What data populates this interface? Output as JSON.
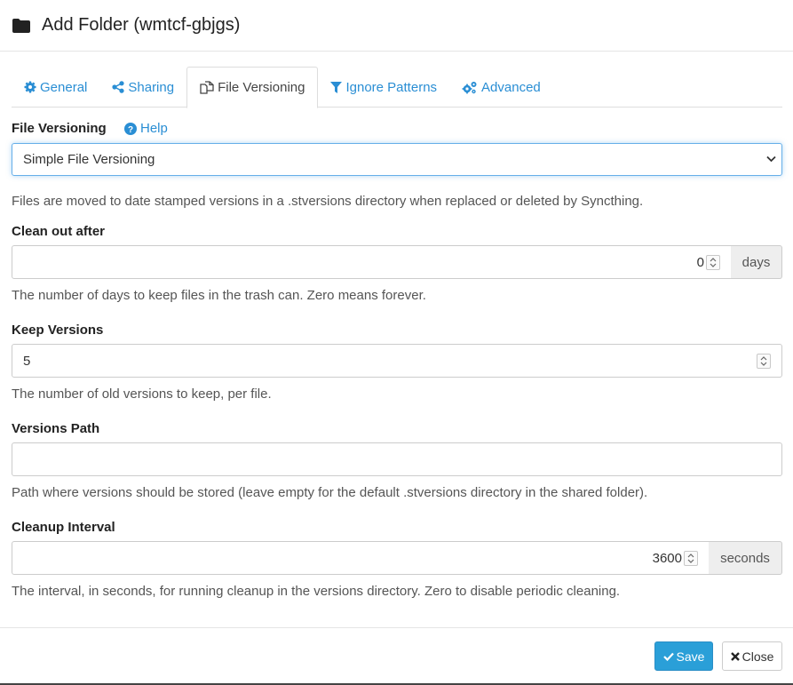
{
  "dialog": {
    "title": "Add Folder (wmtcf-gbjgs)"
  },
  "tabs": [
    {
      "label": "General",
      "icon": "gear-icon"
    },
    {
      "label": "Sharing",
      "icon": "share-icon"
    },
    {
      "label": "File Versioning",
      "icon": "copy-icon",
      "active": true
    },
    {
      "label": "Ignore Patterns",
      "icon": "filter-icon"
    },
    {
      "label": "Advanced",
      "icon": "cogs-icon"
    }
  ],
  "versioning": {
    "label": "File Versioning",
    "help": "Help",
    "selected": "Simple File Versioning",
    "description": "Files are moved to date stamped versions in a .stversions directory when replaced or deleted by Syncthing."
  },
  "clean_out": {
    "label": "Clean out after",
    "value": "0",
    "unit": "days",
    "hint": "The number of days to keep files in the trash can. Zero means forever."
  },
  "keep_versions": {
    "label": "Keep Versions",
    "value": "5",
    "hint": "The number of old versions to keep, per file."
  },
  "versions_path": {
    "label": "Versions Path",
    "value": "",
    "hint": "Path where versions should be stored (leave empty for the default .stversions directory in the shared folder)."
  },
  "cleanup_interval": {
    "label": "Cleanup Interval",
    "value": "3600",
    "unit": "seconds",
    "hint": "The interval, in seconds, for running cleanup in the versions directory. Zero to disable periodic cleaning."
  },
  "footer": {
    "save": "Save",
    "close": "Close"
  },
  "colors": {
    "accent": "#2a8ed4",
    "save_bg": "#2a9fd8"
  }
}
